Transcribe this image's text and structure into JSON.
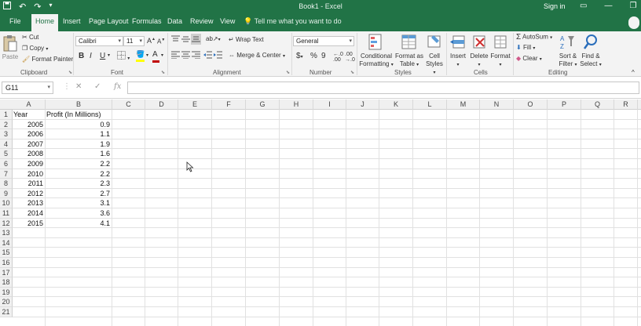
{
  "window": {
    "title": "Book1 - Excel",
    "signin": "Sign in"
  },
  "tabs": {
    "file": "File",
    "home": "Home",
    "insert": "Insert",
    "page_layout": "Page Layout",
    "formulas": "Formulas",
    "data": "Data",
    "review": "Review",
    "view": "View",
    "tell_me": "Tell me what you want to do"
  },
  "ribbon": {
    "clipboard": {
      "label": "Clipboard",
      "paste": "Paste",
      "cut": "Cut",
      "copy": "Copy",
      "format_painter": "Format Painter"
    },
    "font": {
      "label": "Font",
      "name": "Calibri",
      "size": "11",
      "bold": "B",
      "italic": "I",
      "underline": "U"
    },
    "alignment": {
      "label": "Alignment",
      "wrap_text": "Wrap Text",
      "merge_center": "Merge & Center"
    },
    "number": {
      "label": "Number",
      "format": "General",
      "currency": "$",
      "percent": "%",
      "comma": "9"
    },
    "styles": {
      "label": "Styles",
      "conditional": "Conditional",
      "conditional2": "Formatting",
      "format_as": "Format as",
      "format_as2": "Table",
      "cell": "Cell",
      "cell2": "Styles"
    },
    "cells": {
      "label": "Cells",
      "insert": "Insert",
      "delete": "Delete",
      "format": "Format"
    },
    "editing": {
      "label": "Editing",
      "autosum": "AutoSum",
      "fill": "Fill",
      "clear": "Clear",
      "sort": "Sort &",
      "sort2": "Filter",
      "find": "Find &",
      "find2": "Select"
    }
  },
  "formula_bar": {
    "name_box": "G11",
    "fx": "fx",
    "value": ""
  },
  "sheet": {
    "columns": [
      "A",
      "B",
      "C",
      "D",
      "E",
      "F",
      "G",
      "H",
      "I",
      "J",
      "K",
      "L",
      "M",
      "N",
      "O",
      "P",
      "Q",
      "R"
    ],
    "row_numbers": [
      "1",
      "2",
      "3",
      "4",
      "5",
      "6",
      "7",
      "8",
      "9",
      "10",
      "11",
      "12",
      "13",
      "14",
      "15",
      "16",
      "17",
      "18",
      "19",
      "20",
      "21"
    ],
    "header": {
      "a": "Year",
      "b": "Profit (In Millions)"
    },
    "rows": [
      {
        "year": "2005",
        "profit": "0.9"
      },
      {
        "year": "2006",
        "profit": "1.1"
      },
      {
        "year": "2007",
        "profit": "1.9"
      },
      {
        "year": "2008",
        "profit": "1.6"
      },
      {
        "year": "2009",
        "profit": "2.2"
      },
      {
        "year": "2010",
        "profit": "2.2"
      },
      {
        "year": "2011",
        "profit": "2.3"
      },
      {
        "year": "2012",
        "profit": "2.7"
      },
      {
        "year": "2013",
        "profit": "3.1"
      },
      {
        "year": "2014",
        "profit": "3.6"
      },
      {
        "year": "2015",
        "profit": "4.1"
      }
    ]
  },
  "colors": {
    "brand": "#217346",
    "ribbon_bg": "#f3f3f3",
    "font_color": "#c00000",
    "highlight": "#ffff00"
  }
}
